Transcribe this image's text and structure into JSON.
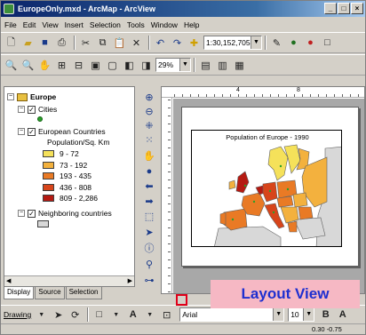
{
  "window": {
    "title": "EuropeOnly.mxd - ArcMap - ArcView"
  },
  "menu": [
    "File",
    "Edit",
    "View",
    "Insert",
    "Selection",
    "Tools",
    "Window",
    "Help"
  ],
  "toolbar": {
    "scale_value": "1:30,152,705",
    "zoom_value": "29%"
  },
  "toc": {
    "data_frame": "Europe",
    "layers": [
      {
        "name": "Cities",
        "checked": true
      },
      {
        "name": "European Countries",
        "checked": true,
        "field": "Population/Sq. Km"
      },
      {
        "name": "Neighboring countries",
        "checked": true
      }
    ],
    "classes": [
      {
        "label": "9 - 72",
        "color": "#f5e15a"
      },
      {
        "label": "73 - 192",
        "color": "#f3b13e"
      },
      {
        "label": "193 - 435",
        "color": "#e97a25"
      },
      {
        "label": "436 - 808",
        "color": "#d7451b"
      },
      {
        "label": "809 - 2,286",
        "color": "#b51a12"
      }
    ],
    "neighbor_color": "#d8d8d8",
    "city_color": "#2aa02a",
    "tabs": [
      "Display",
      "Source",
      "Selection"
    ]
  },
  "layout": {
    "map_title": "Population of Europe - 1990",
    "ruler_marks": [
      "4",
      "8"
    ]
  },
  "drawing": {
    "label": "Drawing",
    "font": "Arial",
    "font_size": "10",
    "bold": "B",
    "italic": "A"
  },
  "status": {
    "coords": "0.30 -0.75"
  },
  "callout": {
    "text": "Layout View",
    "bg_color": "#f6b8c4",
    "text_color": "#1e2fd0"
  }
}
